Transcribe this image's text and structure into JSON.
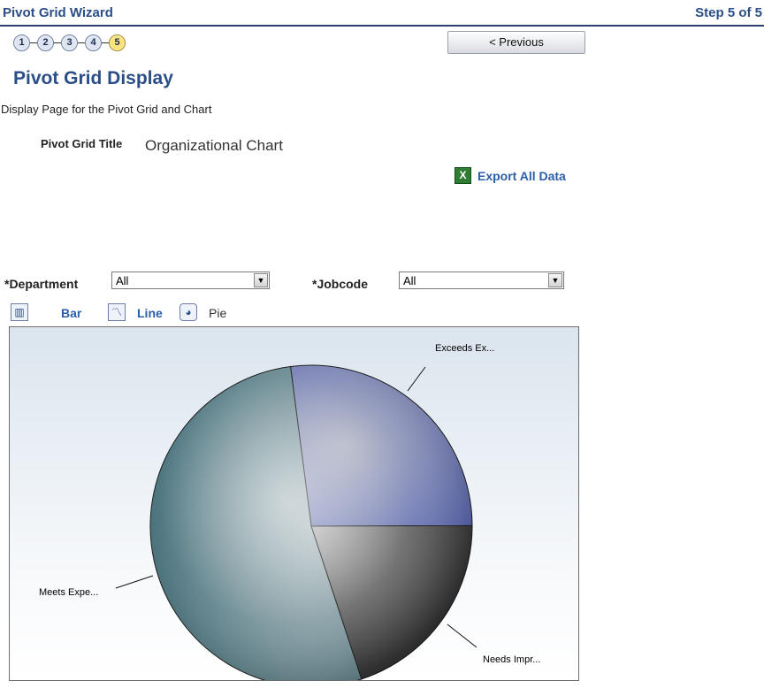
{
  "header": {
    "wizard_title": "Pivot Grid Wizard",
    "step_label": "Step 5 of 5"
  },
  "steps": [
    {
      "label": "1"
    },
    {
      "label": "2"
    },
    {
      "label": "3"
    },
    {
      "label": "4"
    },
    {
      "label": "5",
      "current": true
    }
  ],
  "previous_button": "< Previous",
  "page": {
    "title": "Pivot Grid Display",
    "description": "Display Page for the Pivot Grid and Chart"
  },
  "pivot_grid_title": {
    "label": "Pivot Grid Title",
    "value": "Organizational Chart"
  },
  "export_all": "Export All Data",
  "filters": {
    "department": {
      "label": "*Department",
      "value": "All"
    },
    "jobcode": {
      "label": "*Jobcode",
      "value": "All"
    }
  },
  "chart_tabs": {
    "bar": "Bar",
    "line": "Line",
    "pie": "Pie"
  },
  "colors": {
    "header_text": "#2b4e88",
    "link": "#2b5ea8",
    "current_step": "#f9e37b"
  },
  "chart_data": {
    "type": "pie",
    "slices": [
      {
        "label": "Exceeds Ex...",
        "value": 27,
        "color": "#4a5aa8"
      },
      {
        "label": "Needs Impr...",
        "value": 20,
        "color": "#3d3d3d"
      },
      {
        "label": "Meets Expe...",
        "value": 53,
        "color": "#2f6f7a"
      }
    ]
  }
}
